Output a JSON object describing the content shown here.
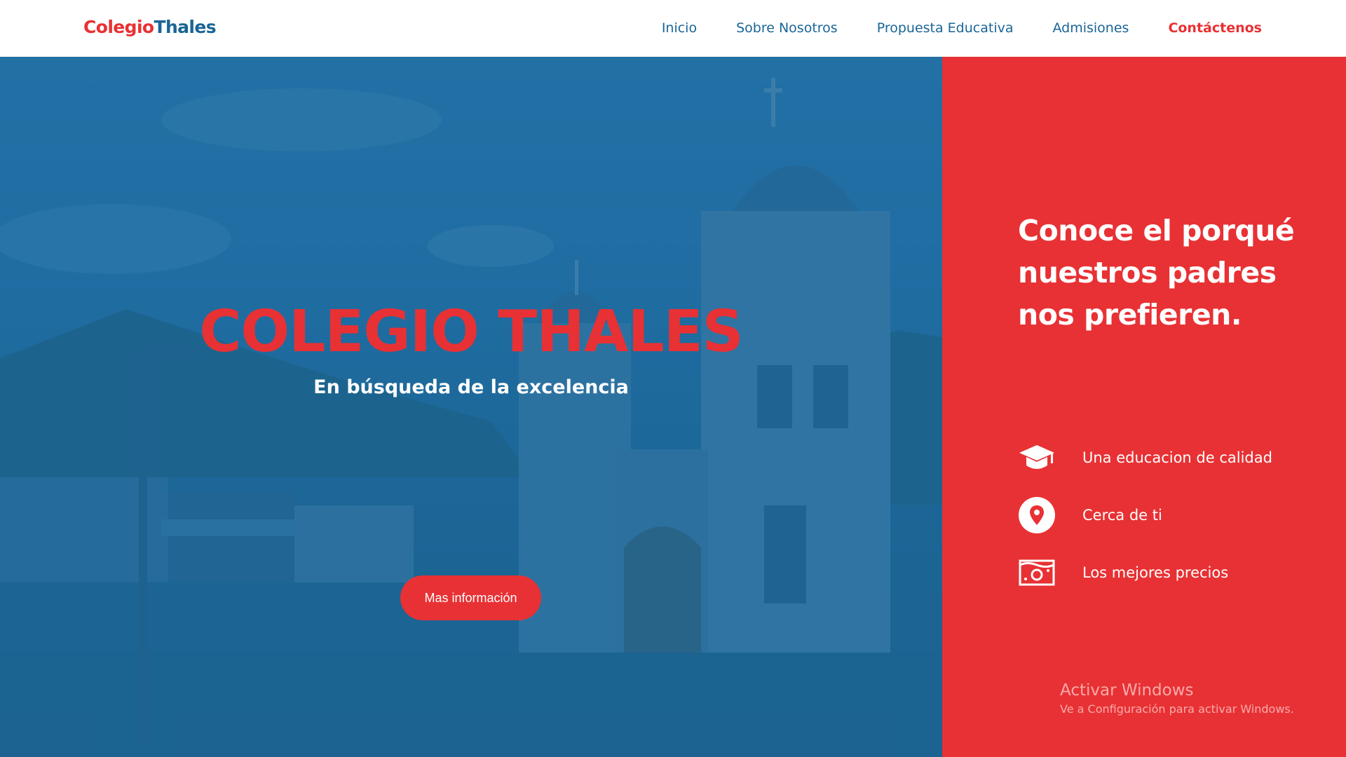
{
  "brand": {
    "part1": "Colegio",
    "part2": "Thales"
  },
  "nav": {
    "items": [
      {
        "label": "Inicio"
      },
      {
        "label": "Sobre Nosotros"
      },
      {
        "label": "Propuesta Educativa"
      },
      {
        "label": "Admisiones"
      },
      {
        "label": "Contáctenos"
      }
    ],
    "active": "Contáctenos"
  },
  "hero": {
    "title": "COLEGIO THALES",
    "subtitle": "En búsqueda de la excelencia",
    "button_label": "Mas información"
  },
  "side": {
    "title": "Conoce el porqué nuestros padres nos prefieren.",
    "features": [
      {
        "icon": "graduation-cap-icon",
        "label": "Una educacion de calidad"
      },
      {
        "icon": "location-pin-icon",
        "label": "Cerca de ti"
      },
      {
        "icon": "money-bill-icon",
        "label": "Los mejores precios"
      }
    ]
  },
  "watermark": {
    "title": "Activar Windows",
    "subtitle": "Ve a Configuración para activar Windows."
  },
  "colors": {
    "brand_red": "#e83134",
    "brand_blue": "#1a6596",
    "overlay_blue": "#14669e",
    "white": "#ffffff"
  }
}
